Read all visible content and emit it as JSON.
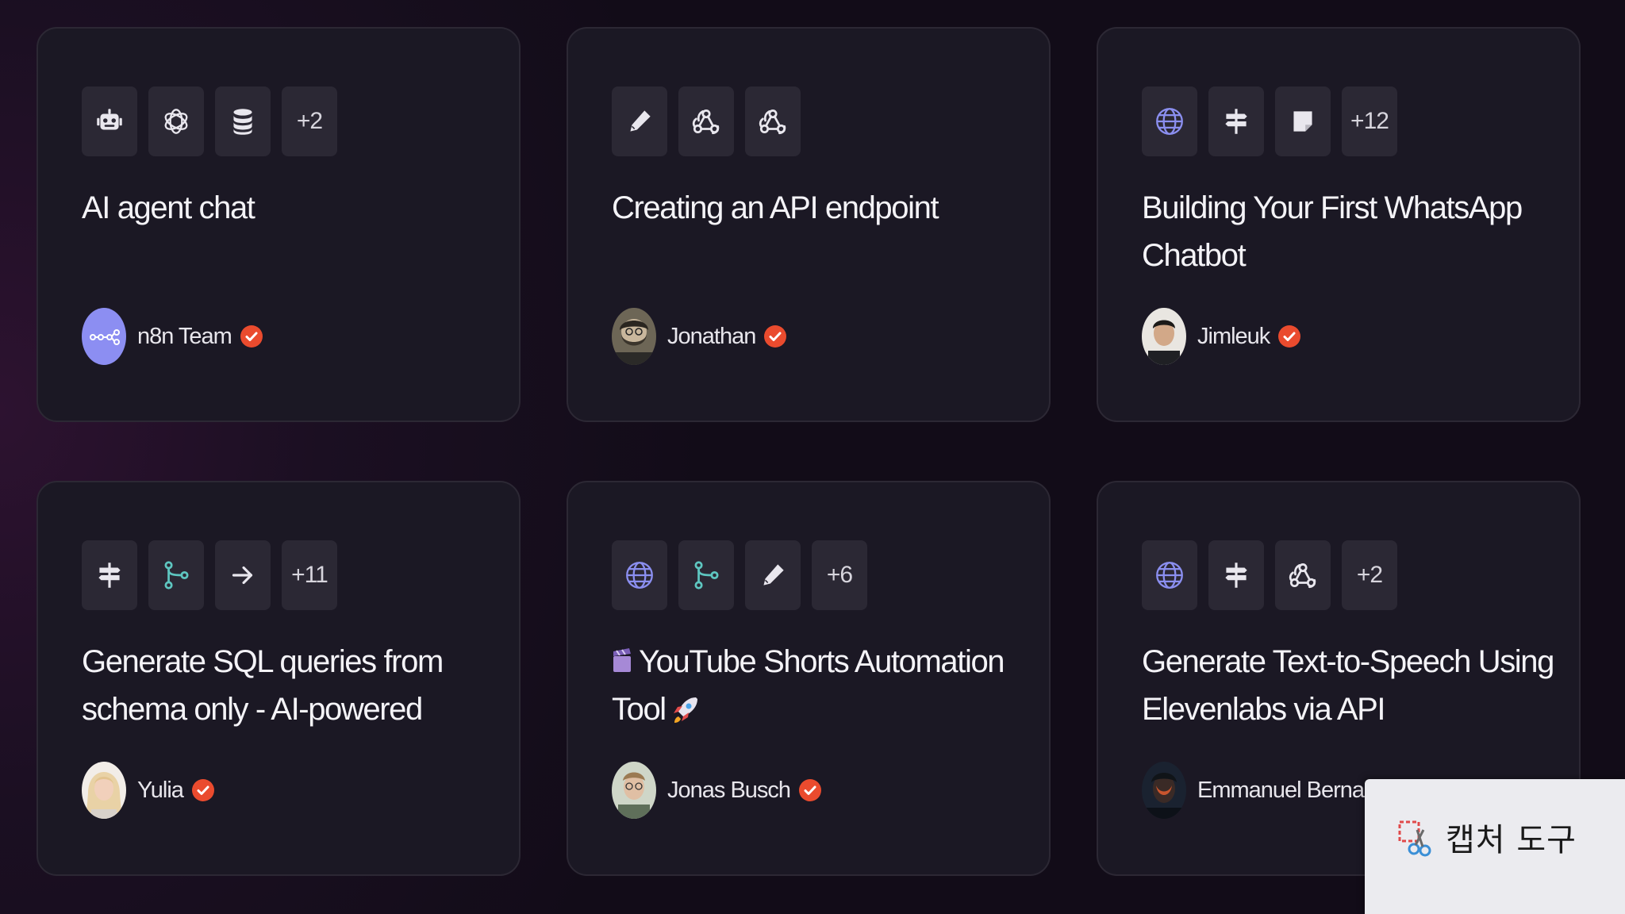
{
  "colors": {
    "background": "#120c18",
    "card": "#1b1824",
    "icon_box": "#2b2834",
    "verified": "#ea4b2e",
    "n8n_avatar": "#8c8ef2",
    "teal_icon": "#5ec6c0",
    "globe_icon": "#8b8ff0"
  },
  "cards": [
    {
      "icons": [
        "robot-icon",
        "openai-icon",
        "database-icon"
      ],
      "more": "+2",
      "title": "AI agent chat",
      "author": "n8n Team",
      "avatar": "n8n-logo-avatar",
      "verified": true
    },
    {
      "icons": [
        "pencil-icon",
        "webhook-icon",
        "webhook-icon"
      ],
      "more": "",
      "title": "Creating an API endpoint",
      "author": "Jonathan",
      "avatar": "bearded-man-avatar",
      "verified": true
    },
    {
      "icons": [
        "globe-icon",
        "signpost-icon",
        "sticky-note-icon"
      ],
      "more": "+12",
      "title": "Building Your First WhatsApp Chatbot",
      "author": "Jimleuk",
      "avatar": "man-avatar",
      "verified": true
    },
    {
      "icons": [
        "signpost-icon",
        "branch-icon",
        "arrow-right-icon"
      ],
      "more": "+11",
      "title": "Generate SQL queries from schema only - AI-powered",
      "author": "Yulia",
      "avatar": "woman-avatar",
      "verified": true
    },
    {
      "icons": [
        "globe-icon",
        "branch-icon",
        "pencil-icon"
      ],
      "more": "+6",
      "title_prefix_emoji": "clapper-board-emoji",
      "title": "YouTube Shorts Automation Tool",
      "title_suffix_emoji": "rocket-emoji",
      "author": "Jonas Busch",
      "avatar": "man-glasses-avatar",
      "verified": true
    },
    {
      "icons": [
        "globe-icon",
        "signpost-icon",
        "webhook-icon"
      ],
      "more": "+2",
      "title": "Generate Text-to-Speech Using Elevenlabs via API",
      "author": "Emmanuel Bernard",
      "avatar": "dark-portrait-avatar",
      "verified": true
    }
  ],
  "capture_tool": {
    "label": "캡처 도구",
    "icon": "snipping-tool-icon"
  }
}
